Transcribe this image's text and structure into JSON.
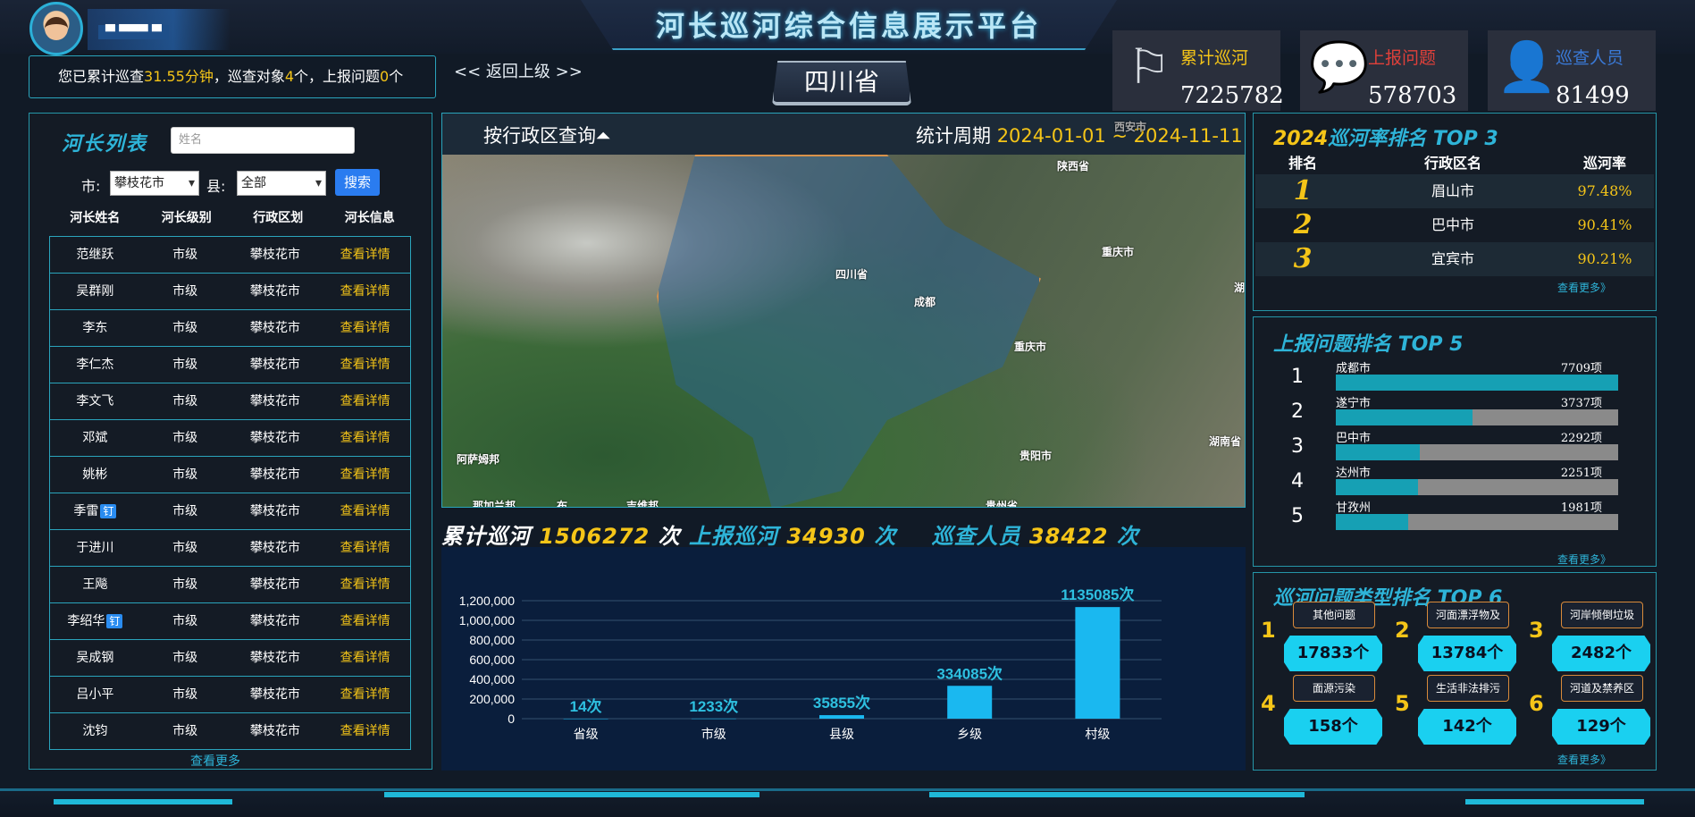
{
  "header": {
    "title": "河长巡河综合信息展示平台",
    "username": "▀ ▀▀▀ ▀",
    "summary": {
      "pre": "您已累计巡查",
      "minutes": "31.55分钟",
      "mid": "，巡查对象",
      "objects": "4",
      "mid2": "个，上报问题",
      "issues": "0",
      "post": "个"
    },
    "back_label": "<< 返回上级 >>",
    "province": "四川省"
  },
  "stats": [
    {
      "label": "累计巡河",
      "value": "7225782",
      "icon": "flag-icon",
      "color": "#f5c518"
    },
    {
      "label": "上报问题",
      "value": "578703",
      "icon": "chat-icon",
      "color": "#e0403a"
    },
    {
      "label": "巡查人员",
      "value": "81499",
      "icon": "person-icon",
      "color": "#3a7ad8"
    }
  ],
  "left_panel": {
    "title": "河长列表",
    "name_placeholder": "姓名",
    "city_label": "市:",
    "city_value": "攀枝花市",
    "county_label": "县:",
    "county_value": "全部",
    "search_label": "搜索",
    "columns": [
      "河长姓名",
      "河长级别",
      "行政区划",
      "河长信息"
    ],
    "rows": [
      {
        "name": "范继跃",
        "level": "市级",
        "region": "攀枝花市",
        "link": "查看详情",
        "tag": ""
      },
      {
        "name": "吴群刚",
        "level": "市级",
        "region": "攀枝花市",
        "link": "查看详情",
        "tag": ""
      },
      {
        "name": "李东",
        "level": "市级",
        "region": "攀枝花市",
        "link": "查看详情",
        "tag": ""
      },
      {
        "name": "李仁杰",
        "level": "市级",
        "region": "攀枝花市",
        "link": "查看详情",
        "tag": ""
      },
      {
        "name": "李文飞",
        "level": "市级",
        "region": "攀枝花市",
        "link": "查看详情",
        "tag": ""
      },
      {
        "name": "邓斌",
        "level": "市级",
        "region": "攀枝花市",
        "link": "查看详情",
        "tag": ""
      },
      {
        "name": "姚彬",
        "level": "市级",
        "region": "攀枝花市",
        "link": "查看详情",
        "tag": ""
      },
      {
        "name": "季雷",
        "level": "市级",
        "region": "攀枝花市",
        "link": "查看详情",
        "tag": "钉"
      },
      {
        "name": "于进川",
        "level": "市级",
        "region": "攀枝花市",
        "link": "查看详情",
        "tag": ""
      },
      {
        "name": "王飚",
        "level": "市级",
        "region": "攀枝花市",
        "link": "查看详情",
        "tag": ""
      },
      {
        "name": "李绍华",
        "level": "市级",
        "region": "攀枝花市",
        "link": "查看详情",
        "tag": "钉"
      },
      {
        "name": "吴成钢",
        "level": "市级",
        "region": "攀枝花市",
        "link": "查看详情",
        "tag": ""
      },
      {
        "name": "吕小平",
        "level": "市级",
        "region": "攀枝花市",
        "link": "查看详情",
        "tag": ""
      },
      {
        "name": "沈钧",
        "level": "市级",
        "region": "攀枝花市",
        "link": "查看详情",
        "tag": ""
      }
    ],
    "more": "查看更多"
  },
  "map": {
    "query_label": "按行政区查询",
    "period_label": "统计周期",
    "period_value": "2024-01-01 ~ 2024-11-11",
    "places": [
      "西安市",
      "陕西省",
      "四川省",
      "成都",
      "重庆市",
      "重庆市",
      "湖",
      "湖南省",
      "贵阳市",
      "贵州省",
      "阿萨姆邦",
      "那加兰邦",
      "布",
      "吉维邦"
    ]
  },
  "summary_line": {
    "l1": "累计巡河",
    "v1": "1506272",
    "u1": "次",
    "l2": "上报巡河",
    "v2": "34930",
    "u2": "次",
    "l3": "巡查人员",
    "v3": "38422",
    "u3": "次"
  },
  "chart_data": {
    "type": "bar",
    "categories": [
      "省级",
      "市级",
      "县级",
      "乡级",
      "村级"
    ],
    "values": [
      14,
      1233,
      35855,
      334085,
      1135085
    ],
    "labels": [
      "14次",
      "1233次",
      "35855次",
      "334085次",
      "1135085次"
    ],
    "yticks": [
      "0",
      "200,000",
      "400,000",
      "600,000",
      "800,000",
      "1,000,000",
      "1,200,000"
    ],
    "ylim": [
      0,
      1200000
    ],
    "color": "#1ab8f0"
  },
  "rank1": {
    "title_year": "2024",
    "title_text": "巡河率排名 TOP 3",
    "columns": [
      "排名",
      "行政区名",
      "巡河率"
    ],
    "rows": [
      {
        "rank": "1",
        "name": "眉山市",
        "rate": "97.48%"
      },
      {
        "rank": "2",
        "name": "巴中市",
        "rate": "90.41%"
      },
      {
        "rank": "3",
        "name": "宜宾市",
        "rate": "90.21%"
      }
    ],
    "more": "查看更多》"
  },
  "rank2": {
    "title": "上报问题排名 TOP 5",
    "items": [
      {
        "idx": "1",
        "name": "成都市",
        "value": "7709项",
        "ratio": 1.0
      },
      {
        "idx": "2",
        "name": "遂宁市",
        "value": "3737项",
        "ratio": 0.485
      },
      {
        "idx": "3",
        "name": "巴中市",
        "value": "2292项",
        "ratio": 0.297
      },
      {
        "idx": "4",
        "name": "达州市",
        "value": "2251项",
        "ratio": 0.292
      },
      {
        "idx": "5",
        "name": "甘孜州",
        "value": "1981项",
        "ratio": 0.257
      }
    ],
    "more": "查看更多》"
  },
  "rank3": {
    "title": "巡河问题类型排名 TOP 6",
    "items": [
      {
        "rank": "1",
        "label": "其他问题",
        "value": "17833个"
      },
      {
        "rank": "2",
        "label": "河面漂浮物及",
        "value": "13784个"
      },
      {
        "rank": "3",
        "label": "河岸倾倒垃圾",
        "value": "2482个"
      },
      {
        "rank": "4",
        "label": "面源污染",
        "value": "158个"
      },
      {
        "rank": "5",
        "label": "生活非法排污",
        "value": "142个"
      },
      {
        "rank": "6",
        "label": "河道及禁养区",
        "value": "129个"
      }
    ],
    "more": "查看更多》"
  }
}
